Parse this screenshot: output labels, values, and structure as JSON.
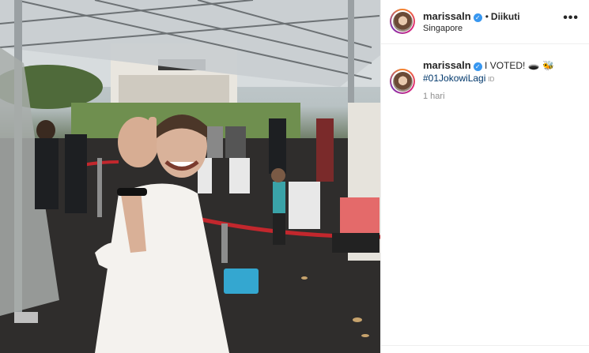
{
  "post": {
    "username": "marissaln",
    "verified_icon": "verified-badge-icon",
    "follow_status": "Diikuti",
    "location": "Singapore",
    "more_icon": "more-options-icon",
    "more_label": "•••",
    "caption": {
      "username": "marissaln",
      "text": "I VOTED!",
      "emoji": "🕳️ 🐝",
      "hashtag": "#01JokowiLagi",
      "lang_tag": "ID",
      "time": "1 hari"
    }
  },
  "colors": {
    "link": "#00376b",
    "verified": "#3897f0",
    "muted": "#8e8e8e",
    "border": "#efefef"
  }
}
